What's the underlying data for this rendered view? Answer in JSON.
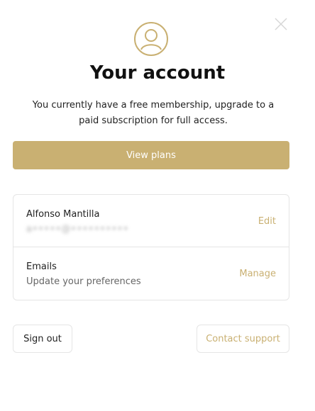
{
  "header": {
    "close_icon": "close-icon",
    "avatar_icon": "user-avatar-icon",
    "title": "Your account",
    "description": "You currently have a free membership, upgrade to a paid subscription for full access."
  },
  "plans_button_label": "View plans",
  "profile": {
    "name": "Alfonso Mantilla",
    "email_redacted": "a•••••@••••••••••",
    "action_label": "Edit"
  },
  "emails": {
    "title": "Emails",
    "subtitle": "Update your preferences",
    "action_label": "Manage"
  },
  "footer": {
    "signout_label": "Sign out",
    "support_label": "Contact support"
  },
  "colors": {
    "accent": "#c9b072",
    "border": "#e5e5e5",
    "text": "#1f1f1f",
    "muted": "#666666"
  }
}
